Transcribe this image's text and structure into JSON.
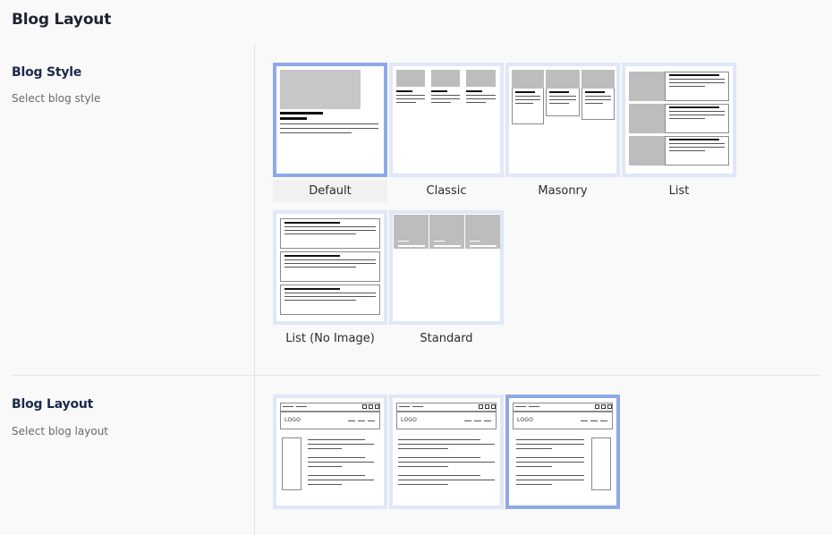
{
  "page": {
    "title": "Blog Layout"
  },
  "blog_style": {
    "title": "Blog Style",
    "description": "Select blog style",
    "selected": "Default",
    "options": [
      {
        "label": "Default"
      },
      {
        "label": "Classic"
      },
      {
        "label": "Masonry"
      },
      {
        "label": "List"
      },
      {
        "label": "List (No Image)"
      },
      {
        "label": "Standard"
      }
    ]
  },
  "blog_layout": {
    "title": "Blog Layout",
    "description": "Select blog layout",
    "selected_index": 2,
    "logo_text": "LOGO",
    "options": [
      {
        "sidebar": "left"
      },
      {
        "sidebar": "none"
      },
      {
        "sidebar": "right"
      }
    ]
  },
  "colors": {
    "selected_border": "#8eaae6",
    "unselected_border": "#dfe7f8",
    "placeholder_image": "#bdbdbd"
  }
}
